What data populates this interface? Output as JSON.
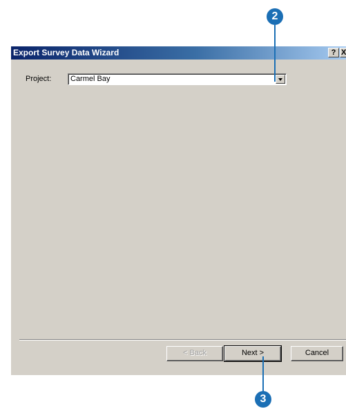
{
  "window": {
    "title": "Export Survey Data Wizard",
    "help_glyph": "?",
    "close_glyph": "X"
  },
  "project": {
    "label": "Project:",
    "value": "Carmel Bay"
  },
  "buttons": {
    "back": "< Back",
    "next": "Next >",
    "cancel": "Cancel"
  },
  "callouts": {
    "step_dropdown": "2",
    "step_next": "3"
  },
  "colors": {
    "callout": "#1b6fb5",
    "titlebar_start": "#0a246a",
    "dialog_face": "#d4d0c8"
  }
}
